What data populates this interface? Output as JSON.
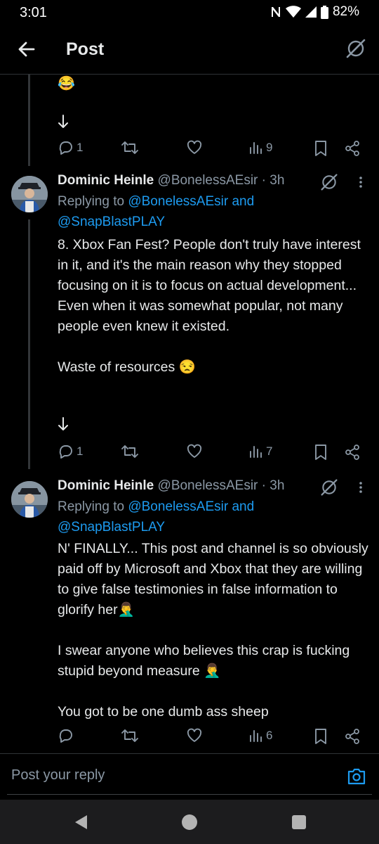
{
  "status_bar": {
    "time": "3:01",
    "battery": "82%",
    "network_icon": "n-icon",
    "wifi_icon": "wifi-icon",
    "signal_icon": "signal-icon",
    "battery_icon": "battery-icon"
  },
  "header": {
    "title": "Post"
  },
  "first_post_tail": {
    "emoji": "😂",
    "metrics": {
      "replies": "1",
      "reposts": "",
      "likes": "",
      "views": "9"
    }
  },
  "posts": [
    {
      "name": "Dominic Heinle",
      "handle": "@BonelessAEsir",
      "time": "· 3h",
      "replying_prefix": "Replying to",
      "replying_users": "@BonelessAEsir and",
      "replying_users2": "@SnapBlastPLAY",
      "paragraphs": [
        "8. Xbox Fan Fest? People don't truly have interest in it, and it's the main reason why they stopped focusing on it is to focus on actual development... Even when it was somewhat popular, not many people even knew it existed.",
        "Waste of resources 😒"
      ],
      "metrics": {
        "replies": "1",
        "reposts": "",
        "likes": "",
        "views": "7"
      }
    },
    {
      "name": "Dominic Heinle",
      "handle": "@BonelessAEsir",
      "time": "· 3h",
      "replying_prefix": "Replying to",
      "replying_users": "@BonelessAEsir and",
      "replying_users2": "@SnapBlastPLAY",
      "paragraphs": [
        "N' FINALLY... This post and channel is so obviously paid off by Microsoft and Xbox that they are willing to give false testimonies in false information to glorify her🤦‍♂️",
        "I swear anyone who believes this crap is fucking stupid beyond measure 🤦‍♂️",
        "You got to be one dumb ass sheep"
      ],
      "metrics": {
        "replies": "",
        "reposts": "",
        "likes": "",
        "views": "6"
      }
    }
  ],
  "compose": {
    "placeholder": "Post your reply"
  },
  "colors": {
    "background": "#000000",
    "text": "#e7e9ea",
    "muted": "#8b98a5",
    "link": "#1d9bf0",
    "border": "#2f3336"
  }
}
